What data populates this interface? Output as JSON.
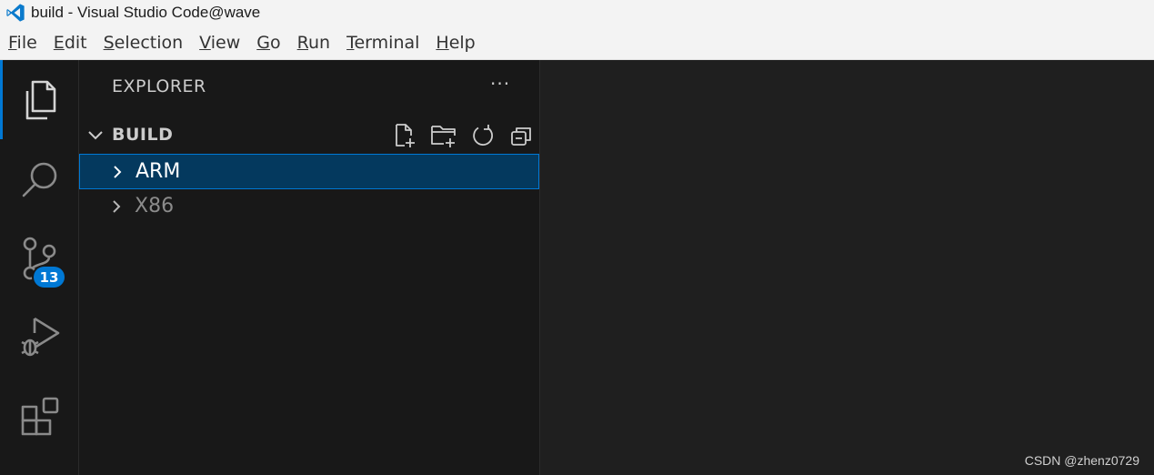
{
  "titlebar": {
    "title": "build - Visual Studio Code@wave",
    "logo_icon": "vscode-logo-icon"
  },
  "menubar": {
    "items": [
      {
        "mnemonic": "F",
        "rest": "ile"
      },
      {
        "mnemonic": "E",
        "rest": "dit"
      },
      {
        "mnemonic": "S",
        "rest": "election"
      },
      {
        "mnemonic": "V",
        "rest": "iew"
      },
      {
        "mnemonic": "G",
        "rest": "o"
      },
      {
        "mnemonic": "R",
        "rest": "un"
      },
      {
        "mnemonic": "T",
        "rest": "erminal"
      },
      {
        "mnemonic": "H",
        "rest": "elp"
      }
    ]
  },
  "activitybar": {
    "items": [
      {
        "icon": "files-icon",
        "active": true
      },
      {
        "icon": "search-icon",
        "active": false
      },
      {
        "icon": "source-control-icon",
        "active": false,
        "badge": "13"
      },
      {
        "icon": "run-debug-icon",
        "active": false
      },
      {
        "icon": "extensions-icon",
        "active": false
      }
    ]
  },
  "sidebar": {
    "header": "EXPLORER",
    "more": "···",
    "folder": {
      "name": "BUILD",
      "actions": [
        "new-file-icon",
        "new-folder-icon",
        "refresh-icon",
        "collapse-all-icon"
      ]
    },
    "tree": [
      {
        "label": "ARM",
        "selected": true
      },
      {
        "label": "X86",
        "selected": false
      }
    ]
  },
  "watermark": "CSDN @zhenz0729",
  "colors": {
    "accent": "#0078d4",
    "selection": "#04395e",
    "background": "#1e1e1e",
    "sidebar": "#181818"
  }
}
